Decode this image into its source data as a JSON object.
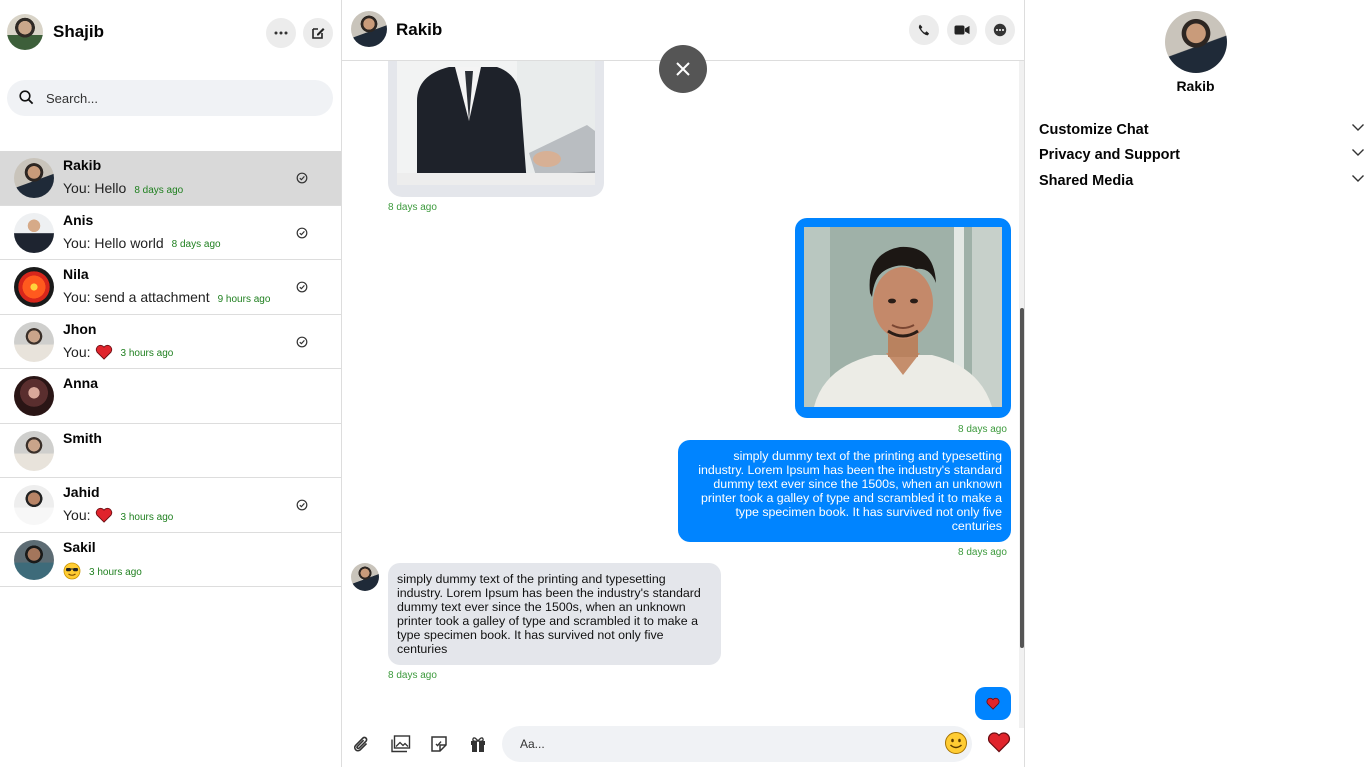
{
  "sidebar": {
    "user_name": "Shajib",
    "search_placeholder": "Search...",
    "conversations": [
      {
        "name": "Rakib",
        "preview": "You: Hello",
        "time": "8 days ago"
      },
      {
        "name": "Anis",
        "preview": "You: Hello world",
        "time": "8 days ago"
      },
      {
        "name": "Nila",
        "preview": "You: send a attachment",
        "time": "9 hours ago"
      },
      {
        "name": "Jhon",
        "preview": "You:",
        "time": "3 hours ago"
      },
      {
        "name": "Anna",
        "preview": "",
        "time": ""
      },
      {
        "name": "Smith",
        "preview": "",
        "time": ""
      },
      {
        "name": "Jahid",
        "preview": "You:",
        "time": "3 hours ago"
      },
      {
        "name": "Sakil",
        "preview": "",
        "time": "3 hours ago"
      }
    ]
  },
  "chat": {
    "peer_name": "Rakib",
    "messages": [
      {
        "type": "image",
        "direction": "received",
        "time": "8 days ago"
      },
      {
        "type": "image",
        "direction": "sent",
        "time": "8 days ago"
      },
      {
        "type": "text",
        "direction": "sent",
        "text": "simply dummy text of the printing and typesetting industry. Lorem Ipsum has been the industry's standard dummy text ever since the 1500s, when an unknown printer took a galley of type and scrambled it to make a type specimen book. It has survived not only five centuries",
        "time": "8 days ago"
      },
      {
        "type": "text",
        "direction": "received",
        "text": "simply dummy text of the printing and typesetting industry. Lorem Ipsum has been the industry's standard dummy text ever since the 1500s, when an unknown printer took a galley of type and scrambled it to make a type specimen book. It has survived not only five centuries",
        "time": "8 days ago"
      },
      {
        "type": "reaction",
        "direction": "sent",
        "icon": "heart-icon"
      }
    ],
    "composer_placeholder": "Aa..."
  },
  "info_panel": {
    "name": "Rakib",
    "sections": [
      "Customize Chat",
      "Privacy and Support",
      "Shared Media"
    ]
  },
  "colors": {
    "accent": "#0084ff",
    "timestamp": "#3c9a3c",
    "bubble_received": "#e4e6eb",
    "active_row": "#d9d9d9"
  }
}
